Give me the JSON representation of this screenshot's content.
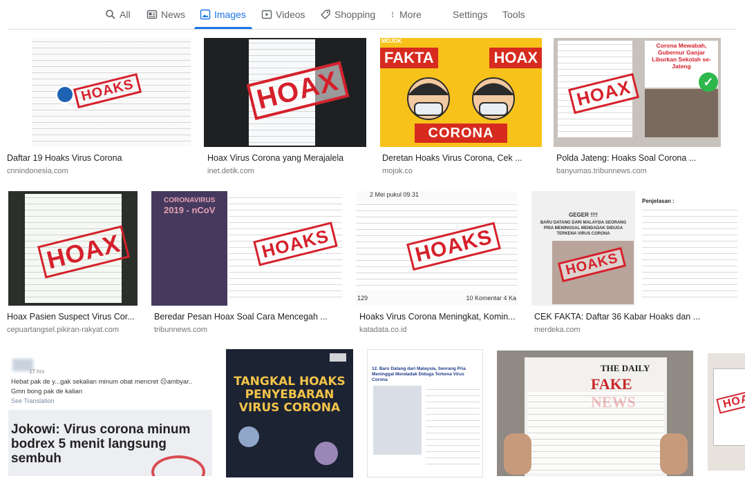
{
  "nav": {
    "tabs": [
      {
        "label": "All",
        "icon": "search-icon"
      },
      {
        "label": "News",
        "icon": "news-icon"
      },
      {
        "label": "Images",
        "icon": "image-icon",
        "active": true
      },
      {
        "label": "Videos",
        "icon": "video-icon"
      },
      {
        "label": "Shopping",
        "icon": "tag-icon"
      },
      {
        "label": "More",
        "icon": "more-vertical-icon"
      }
    ],
    "settings": "Settings",
    "tools": "Tools"
  },
  "colors": {
    "accent": "#1a73e8",
    "stamp_red": "#d5202b",
    "muted": "#70757a"
  },
  "results": [
    {
      "title": "Daftar 19 Hoaks Virus Corona",
      "source": "cnnindonesia.com",
      "stamp": "HOAKS"
    },
    {
      "title": "Hoax Virus Corona yang Merajalela",
      "source": "inet.detik.com",
      "stamp": "HOAX"
    },
    {
      "title": "Deretan Hoaks Virus Corona, Cek ...",
      "source": "mojok.co",
      "left": "FAKTA",
      "right": "HOAX",
      "bottom": "CORONA",
      "brand": "MOJOK"
    },
    {
      "title": "Polda Jateng: Hoaks Soal Corona ...",
      "source": "banyumas.tribunnews.com",
      "stamp": "HOAX",
      "headline": "Corona Mewabah, Gubernur Ganjar Liburkan Sekolah se-Jateng"
    },
    {
      "title": "Hoax Pasien Suspect Virus Cor...",
      "source": "cepuartangsel.pikiran-rakyat.com",
      "stamp": "HOAX"
    },
    {
      "title": "Beredar Pesan Hoax Soal Cara Mencegah ...",
      "source": "tribunnews.com",
      "stamp": "HOAKS",
      "heading1": "CORONAVIRUS",
      "heading2": "2019 - nCoV"
    },
    {
      "title": "Hoaks Virus Corona Meningkat, Komin...",
      "source": "katadata.co.id",
      "stamp": "HOAKS",
      "post_time": "2 Mei pukul 09.31",
      "reactions": "129",
      "comments": "10 Komentar 4 Ka"
    },
    {
      "title": "CEK FAKTA: Daftar 36 Kabar Hoaks dan ...",
      "source": "merdeka.com",
      "stamp": "HOAKS",
      "panel_title": "Penjelasan :",
      "alert": "GEGER !!!!",
      "sub": "BARU DATANG DARI MALAYSIA SEORANG PRIA MENINGGAL MENDADAK DIDUGA TERKENA VIRUS CORONA"
    },
    {
      "title": "",
      "source": "",
      "post_time": "17 hrs",
      "post_text": "Hebat pak de y...gak sekalian minum obat mencret ☹ambyar..",
      "post_text2": "Gmn bong pak de kalian",
      "translate": "See Translation",
      "headline": "Jokowi: Virus corona minum bodrex 5 menit langsung sembuh"
    },
    {
      "title": "",
      "source": "",
      "line1": "TANGKAL HOAKS",
      "line2": "PENYEBARAN",
      "line3": "VIRUS CORONA"
    },
    {
      "title": "",
      "source": "",
      "doc_title": "12. Baru Datang dari Malaysia, Seorang Pria Meninggal Mendadak Diduga Terkena Virus Corona"
    },
    {
      "title": "",
      "source": "",
      "masthead": "THE DAILY",
      "headline": "FAKE NEWS"
    },
    {
      "title": "",
      "source": "",
      "stamp": "HOAX"
    }
  ]
}
